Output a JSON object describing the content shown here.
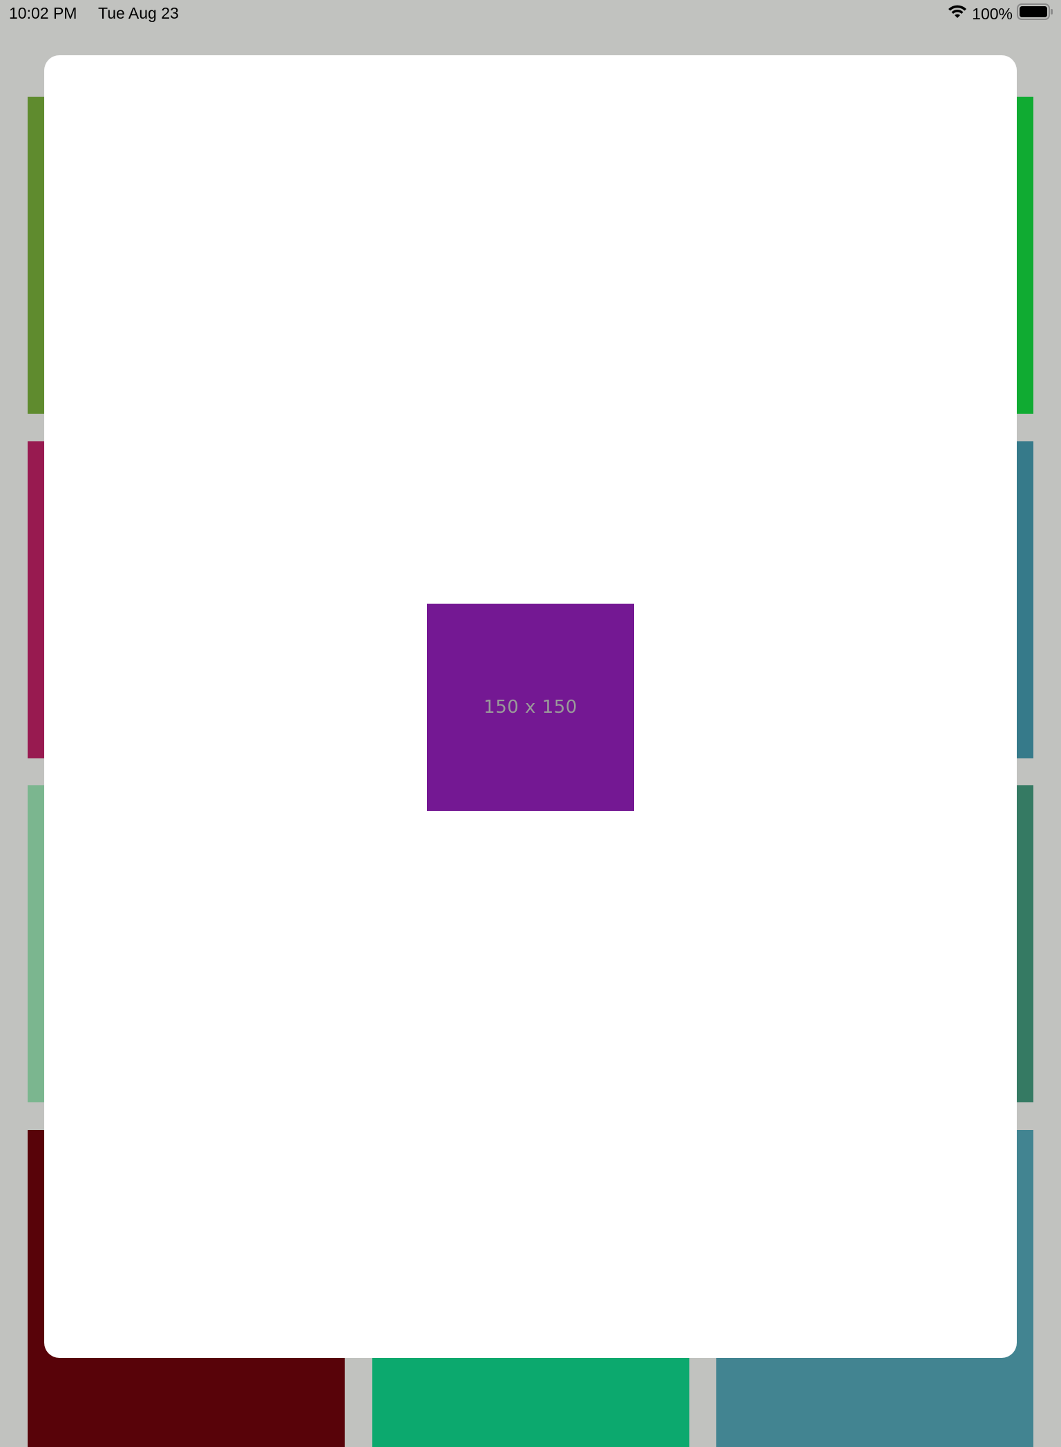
{
  "status_bar": {
    "time": "10:02 PM",
    "date": "Tue Aug 23",
    "battery_percent": "100%",
    "wifi_icon": "wifi-icon",
    "battery_icon": "battery-icon",
    "battery_level": 1.0
  },
  "background_grid": {
    "tile_colors": [
      "#5f8b2e",
      "#000000",
      "#10ab32",
      "#981a50",
      "#000000",
      "#367a8a",
      "#7bb68f",
      "#000000",
      "#357a63",
      "#580309",
      "#0ca96e",
      "#428491"
    ]
  },
  "modal": {
    "image": {
      "label": "150 x 150",
      "background_color": "#741893",
      "text_color": "#9a9a9a"
    }
  }
}
